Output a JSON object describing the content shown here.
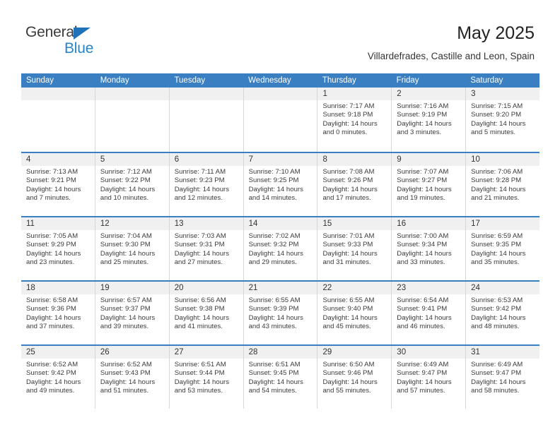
{
  "brand": {
    "name_top": "General",
    "name_bottom": "Blue",
    "accent_color": "#2585cd",
    "triangle_color": "#1e72b8"
  },
  "header": {
    "title": "May 2025",
    "subtitle": "Villardefrades, Castille and Leon, Spain"
  },
  "calendar": {
    "header_bg": "#3a7fc1",
    "daynum_bg": "#f0f0f0",
    "weekdays": [
      "Sunday",
      "Monday",
      "Tuesday",
      "Wednesday",
      "Thursday",
      "Friday",
      "Saturday"
    ],
    "weeks": [
      [
        {
          "day": "",
          "empty": true
        },
        {
          "day": "",
          "empty": true
        },
        {
          "day": "",
          "empty": true
        },
        {
          "day": "",
          "empty": true
        },
        {
          "day": "1",
          "sunrise": "Sunrise: 7:17 AM",
          "sunset": "Sunset: 9:18 PM",
          "daylight1": "Daylight: 14 hours",
          "daylight2": "and 0 minutes."
        },
        {
          "day": "2",
          "sunrise": "Sunrise: 7:16 AM",
          "sunset": "Sunset: 9:19 PM",
          "daylight1": "Daylight: 14 hours",
          "daylight2": "and 3 minutes."
        },
        {
          "day": "3",
          "sunrise": "Sunrise: 7:15 AM",
          "sunset": "Sunset: 9:20 PM",
          "daylight1": "Daylight: 14 hours",
          "daylight2": "and 5 minutes."
        }
      ],
      [
        {
          "day": "4",
          "sunrise": "Sunrise: 7:13 AM",
          "sunset": "Sunset: 9:21 PM",
          "daylight1": "Daylight: 14 hours",
          "daylight2": "and 7 minutes."
        },
        {
          "day": "5",
          "sunrise": "Sunrise: 7:12 AM",
          "sunset": "Sunset: 9:22 PM",
          "daylight1": "Daylight: 14 hours",
          "daylight2": "and 10 minutes."
        },
        {
          "day": "6",
          "sunrise": "Sunrise: 7:11 AM",
          "sunset": "Sunset: 9:23 PM",
          "daylight1": "Daylight: 14 hours",
          "daylight2": "and 12 minutes."
        },
        {
          "day": "7",
          "sunrise": "Sunrise: 7:10 AM",
          "sunset": "Sunset: 9:25 PM",
          "daylight1": "Daylight: 14 hours",
          "daylight2": "and 14 minutes."
        },
        {
          "day": "8",
          "sunrise": "Sunrise: 7:08 AM",
          "sunset": "Sunset: 9:26 PM",
          "daylight1": "Daylight: 14 hours",
          "daylight2": "and 17 minutes."
        },
        {
          "day": "9",
          "sunrise": "Sunrise: 7:07 AM",
          "sunset": "Sunset: 9:27 PM",
          "daylight1": "Daylight: 14 hours",
          "daylight2": "and 19 minutes."
        },
        {
          "day": "10",
          "sunrise": "Sunrise: 7:06 AM",
          "sunset": "Sunset: 9:28 PM",
          "daylight1": "Daylight: 14 hours",
          "daylight2": "and 21 minutes."
        }
      ],
      [
        {
          "day": "11",
          "sunrise": "Sunrise: 7:05 AM",
          "sunset": "Sunset: 9:29 PM",
          "daylight1": "Daylight: 14 hours",
          "daylight2": "and 23 minutes."
        },
        {
          "day": "12",
          "sunrise": "Sunrise: 7:04 AM",
          "sunset": "Sunset: 9:30 PM",
          "daylight1": "Daylight: 14 hours",
          "daylight2": "and 25 minutes."
        },
        {
          "day": "13",
          "sunrise": "Sunrise: 7:03 AM",
          "sunset": "Sunset: 9:31 PM",
          "daylight1": "Daylight: 14 hours",
          "daylight2": "and 27 minutes."
        },
        {
          "day": "14",
          "sunrise": "Sunrise: 7:02 AM",
          "sunset": "Sunset: 9:32 PM",
          "daylight1": "Daylight: 14 hours",
          "daylight2": "and 29 minutes."
        },
        {
          "day": "15",
          "sunrise": "Sunrise: 7:01 AM",
          "sunset": "Sunset: 9:33 PM",
          "daylight1": "Daylight: 14 hours",
          "daylight2": "and 31 minutes."
        },
        {
          "day": "16",
          "sunrise": "Sunrise: 7:00 AM",
          "sunset": "Sunset: 9:34 PM",
          "daylight1": "Daylight: 14 hours",
          "daylight2": "and 33 minutes."
        },
        {
          "day": "17",
          "sunrise": "Sunrise: 6:59 AM",
          "sunset": "Sunset: 9:35 PM",
          "daylight1": "Daylight: 14 hours",
          "daylight2": "and 35 minutes."
        }
      ],
      [
        {
          "day": "18",
          "sunrise": "Sunrise: 6:58 AM",
          "sunset": "Sunset: 9:36 PM",
          "daylight1": "Daylight: 14 hours",
          "daylight2": "and 37 minutes."
        },
        {
          "day": "19",
          "sunrise": "Sunrise: 6:57 AM",
          "sunset": "Sunset: 9:37 PM",
          "daylight1": "Daylight: 14 hours",
          "daylight2": "and 39 minutes."
        },
        {
          "day": "20",
          "sunrise": "Sunrise: 6:56 AM",
          "sunset": "Sunset: 9:38 PM",
          "daylight1": "Daylight: 14 hours",
          "daylight2": "and 41 minutes."
        },
        {
          "day": "21",
          "sunrise": "Sunrise: 6:55 AM",
          "sunset": "Sunset: 9:39 PM",
          "daylight1": "Daylight: 14 hours",
          "daylight2": "and 43 minutes."
        },
        {
          "day": "22",
          "sunrise": "Sunrise: 6:55 AM",
          "sunset": "Sunset: 9:40 PM",
          "daylight1": "Daylight: 14 hours",
          "daylight2": "and 45 minutes."
        },
        {
          "day": "23",
          "sunrise": "Sunrise: 6:54 AM",
          "sunset": "Sunset: 9:41 PM",
          "daylight1": "Daylight: 14 hours",
          "daylight2": "and 46 minutes."
        },
        {
          "day": "24",
          "sunrise": "Sunrise: 6:53 AM",
          "sunset": "Sunset: 9:42 PM",
          "daylight1": "Daylight: 14 hours",
          "daylight2": "and 48 minutes."
        }
      ],
      [
        {
          "day": "25",
          "sunrise": "Sunrise: 6:52 AM",
          "sunset": "Sunset: 9:42 PM",
          "daylight1": "Daylight: 14 hours",
          "daylight2": "and 49 minutes."
        },
        {
          "day": "26",
          "sunrise": "Sunrise: 6:52 AM",
          "sunset": "Sunset: 9:43 PM",
          "daylight1": "Daylight: 14 hours",
          "daylight2": "and 51 minutes."
        },
        {
          "day": "27",
          "sunrise": "Sunrise: 6:51 AM",
          "sunset": "Sunset: 9:44 PM",
          "daylight1": "Daylight: 14 hours",
          "daylight2": "and 53 minutes."
        },
        {
          "day": "28",
          "sunrise": "Sunrise: 6:51 AM",
          "sunset": "Sunset: 9:45 PM",
          "daylight1": "Daylight: 14 hours",
          "daylight2": "and 54 minutes."
        },
        {
          "day": "29",
          "sunrise": "Sunrise: 6:50 AM",
          "sunset": "Sunset: 9:46 PM",
          "daylight1": "Daylight: 14 hours",
          "daylight2": "and 55 minutes."
        },
        {
          "day": "30",
          "sunrise": "Sunrise: 6:49 AM",
          "sunset": "Sunset: 9:47 PM",
          "daylight1": "Daylight: 14 hours",
          "daylight2": "and 57 minutes."
        },
        {
          "day": "31",
          "sunrise": "Sunrise: 6:49 AM",
          "sunset": "Sunset: 9:47 PM",
          "daylight1": "Daylight: 14 hours",
          "daylight2": "and 58 minutes."
        }
      ]
    ]
  }
}
